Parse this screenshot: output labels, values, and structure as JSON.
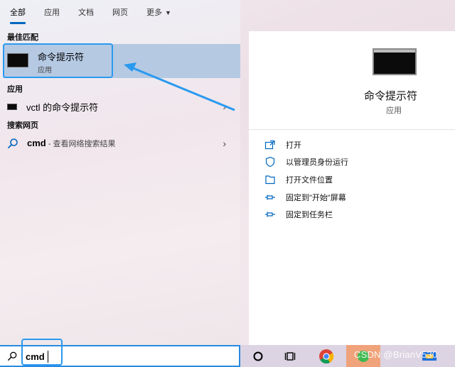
{
  "tabs": [
    "全部",
    "应用",
    "文档",
    "网页",
    "更多"
  ],
  "sections": {
    "best_match": "最佳匹配",
    "apps": "应用",
    "web": "搜索网页"
  },
  "best": {
    "name": "命令提示符",
    "type": "应用"
  },
  "apps_row": {
    "prefix": "vctl",
    "rest": " 的命令提示符"
  },
  "web_row": {
    "query": "cmd",
    "hint": " - 查看网络搜索结果"
  },
  "right": {
    "title": "命令提示符",
    "subtitle": "应用",
    "actions": [
      "打开",
      "以管理员身份运行",
      "打开文件位置",
      "固定到\"开始\"屏幕",
      "固定到任务栏"
    ]
  },
  "search": {
    "value": "cmd"
  },
  "taskbar": {
    "watermark": "CSDN @BrianV530"
  },
  "colors": {
    "accent": "#0067c0",
    "highlight": "#2a9af0",
    "selected": "#b5c9e3"
  },
  "icons": [
    "search-icon",
    "cmd-icon",
    "chevron-right-icon",
    "open-icon",
    "admin-icon",
    "folder-icon",
    "pin-icon",
    "cortana-icon",
    "task-view-icon",
    "chrome-icon"
  ]
}
